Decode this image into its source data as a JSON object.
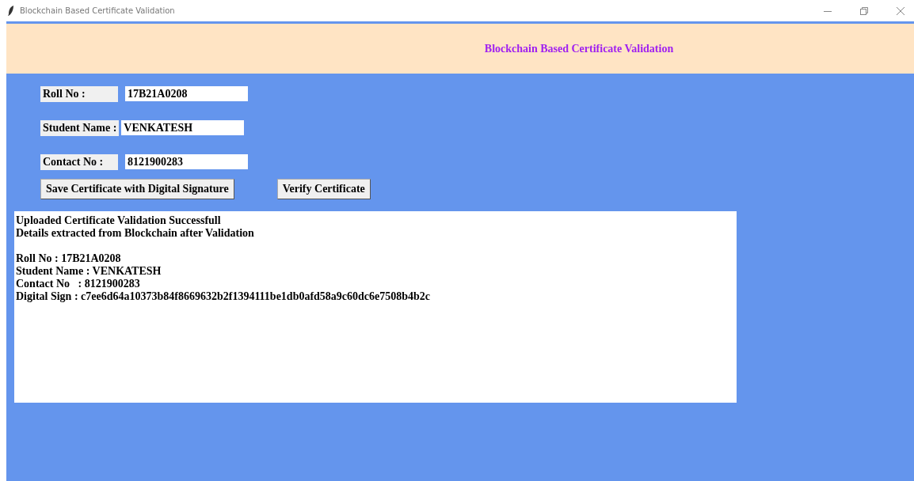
{
  "window": {
    "title": "Blockchain Based Certificate Validation"
  },
  "header": {
    "title": "Blockchain Based Certificate Validation"
  },
  "fields": [
    {
      "label": "Roll No :",
      "value": "17B21A0208"
    },
    {
      "label": "Student Name :",
      "value": "VENKATESH"
    },
    {
      "label": "Contact No :",
      "value": "8121900283"
    }
  ],
  "buttons": [
    "Save Certificate with Digital Signature",
    "Verify Certificate"
  ],
  "output": {
    "paragraphs": [
      [
        "Uploaded Certificate Validation Successfull",
        "Details extracted from Blockchain after Validation"
      ],
      [
        "Roll No : 17B21A0208",
        "Student Name : VENKATESH",
        "Contact No   : 8121900283",
        "Digital Sign : c7ee6d64a10373b84f8669632b2f1394111be1db0afd58a9c60dc6e7508b4b2c"
      ]
    ]
  }
}
